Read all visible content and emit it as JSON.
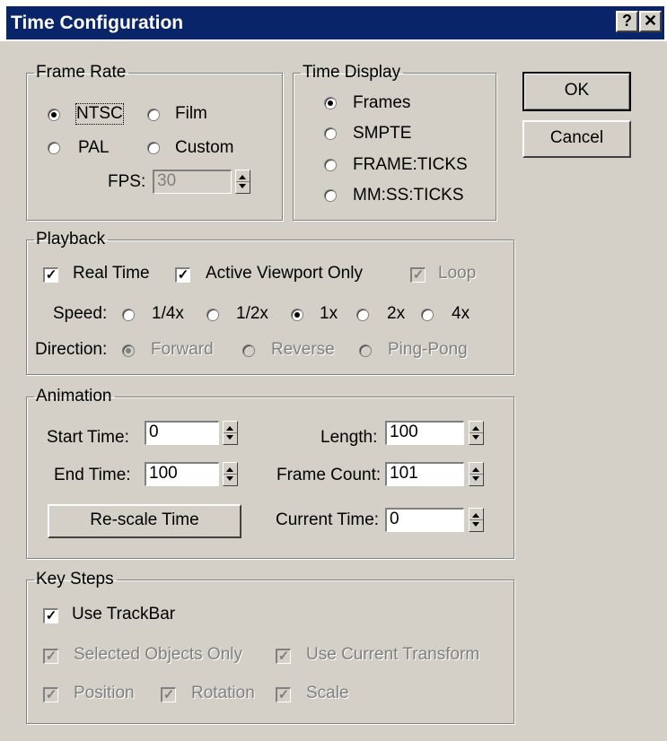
{
  "window": {
    "title": "Time Configuration",
    "help_label": "?",
    "close_label": "✕"
  },
  "buttons": {
    "ok": "OK",
    "cancel": "Cancel"
  },
  "frame_rate": {
    "legend": "Frame Rate",
    "options": {
      "ntsc": "NTSC",
      "film": "Film",
      "pal": "PAL",
      "custom": "Custom"
    },
    "selected": "NTSC",
    "fps_label": "FPS:",
    "fps_value": "30"
  },
  "time_display": {
    "legend": "Time Display",
    "options": [
      "Frames",
      "SMPTE",
      "FRAME:TICKS",
      "MM:SS:TICKS"
    ],
    "selected": "Frames"
  },
  "playback": {
    "legend": "Playback",
    "real_time": "Real Time",
    "active_viewport_only": "Active Viewport Only",
    "loop": "Loop",
    "speed_label": "Speed:",
    "speeds": [
      "1/4x",
      "1/2x",
      "1x",
      "2x",
      "4x"
    ],
    "speed_selected": "1x",
    "direction_label": "Direction:",
    "directions": [
      "Forward",
      "Reverse",
      "Ping-Pong"
    ],
    "direction_selected": "Forward"
  },
  "animation": {
    "legend": "Animation",
    "start_time_label": "Start Time:",
    "start_time": "0",
    "end_time_label": "End Time:",
    "end_time": "100",
    "length_label": "Length:",
    "length": "100",
    "frame_count_label": "Frame Count:",
    "frame_count": "101",
    "current_time_label": "Current Time:",
    "current_time": "0",
    "rescale_button": "Re-scale Time"
  },
  "key_steps": {
    "legend": "Key Steps",
    "use_trackbar": "Use TrackBar",
    "selected_objects_only": "Selected Objects Only",
    "use_current_transform": "Use Current Transform",
    "position": "Position",
    "rotation": "Rotation",
    "scale": "Scale"
  },
  "colors": {
    "titlebar": "#0a246a",
    "face": "#d4d0c8",
    "disabled_text": "#808080"
  }
}
